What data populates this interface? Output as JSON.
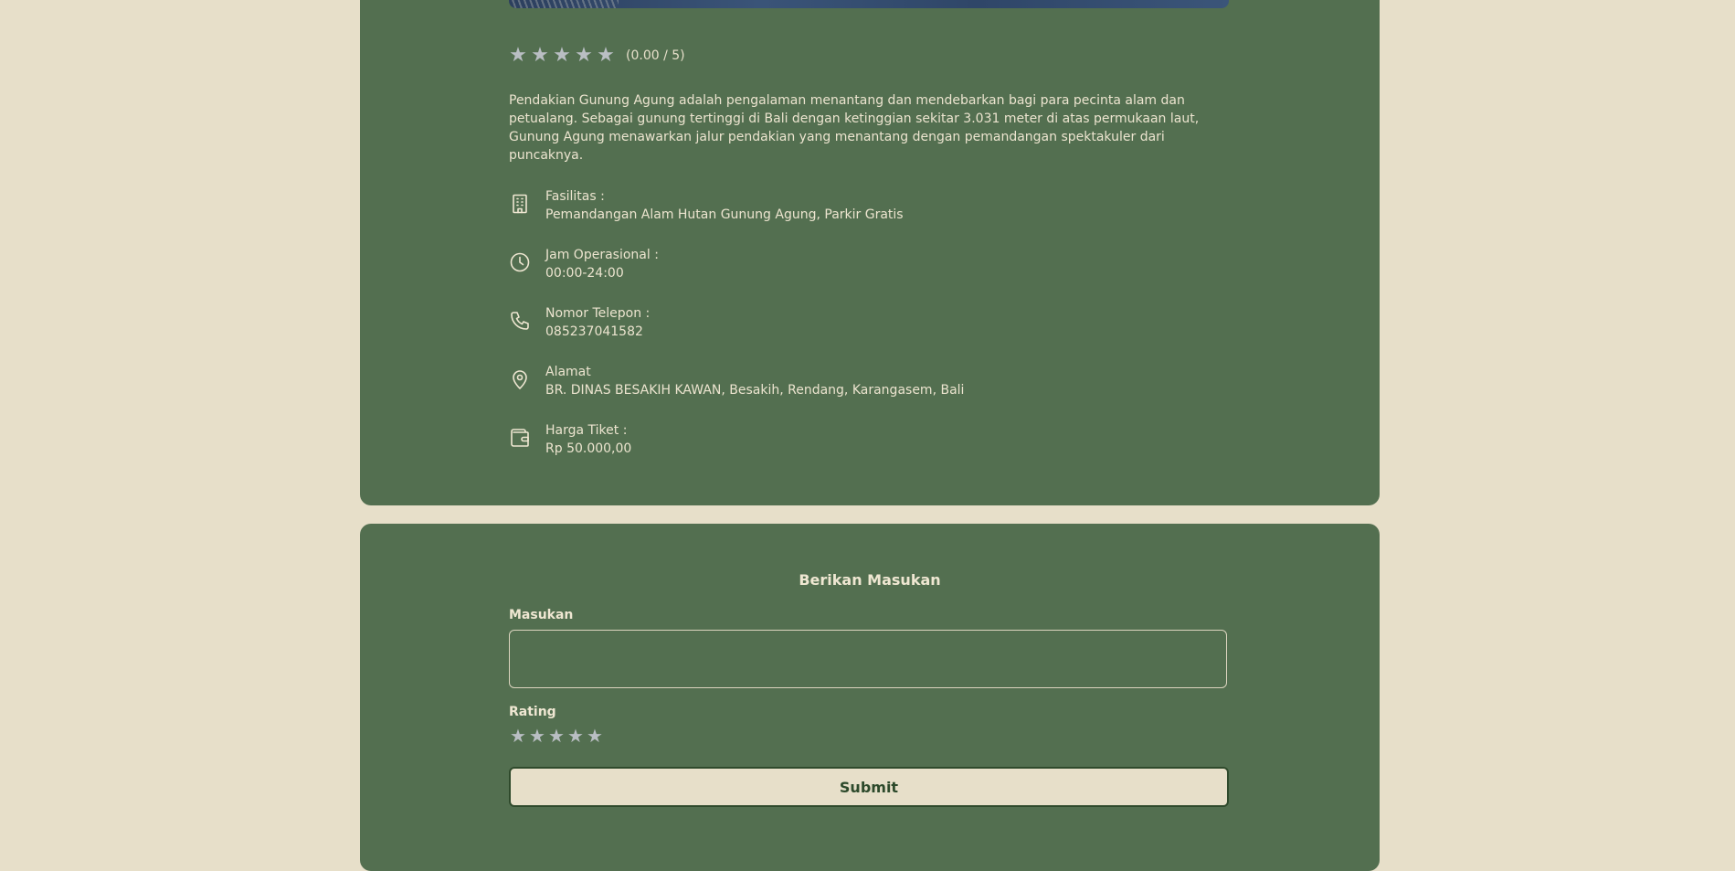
{
  "detail": {
    "stars": [
      "★",
      "★",
      "★",
      "★",
      "★"
    ],
    "rating_value": 0,
    "rating_text": "(0.00 / 5)",
    "description": "Pendakian Gunung Agung adalah pengalaman menantang dan mendebarkan bagi para pecinta alam dan petualang. Sebagai gunung tertinggi di Bali dengan ketinggian sekitar 3.031 meter di atas permukaan laut, Gunung Agung menawarkan jalur pendakian yang menantang dengan pemandangan spektakuler dari puncaknya.",
    "info": [
      {
        "icon": "building-icon",
        "label": "Fasilitas :",
        "value": "Pemandangan Alam Hutan Gunung Agung, Parkir Gratis"
      },
      {
        "icon": "clock-icon",
        "label": "Jam Operasional :",
        "value": "00:00-24:00"
      },
      {
        "icon": "phone-icon",
        "label": "Nomor Telepon :",
        "value": "085237041582"
      },
      {
        "icon": "map-pin-icon",
        "label": "Alamat",
        "value": "BR. DINAS BESAKIH KAWAN, Besakih, Rendang, Karangasem, Bali"
      },
      {
        "icon": "wallet-icon",
        "label": "Harga Tiket :",
        "value": "Rp 50.000,00"
      }
    ]
  },
  "feedback": {
    "title": "Berikan Masukan",
    "masukan_label": "Masukan",
    "masukan_value": "",
    "rating_label": "Rating",
    "rating_stars": [
      "★",
      "★",
      "★",
      "★",
      "★"
    ],
    "submit_label": "Submit"
  },
  "colors": {
    "page_bg": "#e7dfc9",
    "card_bg": "#536f50",
    "star": "#b9bec3",
    "button_text": "#2d4a2b"
  }
}
